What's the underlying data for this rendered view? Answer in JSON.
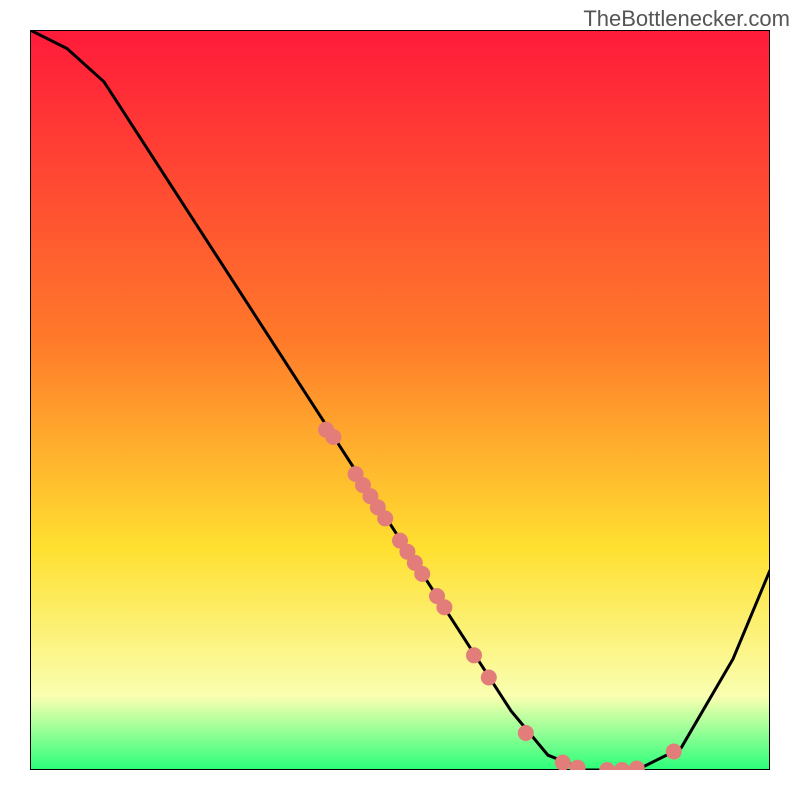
{
  "watermark": "TheBottlenecker.com",
  "chart_data": {
    "type": "line",
    "title": "",
    "xlabel": "",
    "ylabel": "",
    "xlim": [
      0,
      100
    ],
    "ylim": [
      0,
      100
    ],
    "grid": false,
    "gradient_bg": {
      "top": "#ff1a3a",
      "mid1": "#ff7a2a",
      "mid2": "#ffe030",
      "low": "#faffb0",
      "bottom": "#2aff7a"
    },
    "curve": {
      "name": "bottleneck-curve",
      "color": "#000000",
      "points": [
        [
          0,
          100
        ],
        [
          5,
          97.5
        ],
        [
          10,
          93
        ],
        [
          65,
          8
        ],
        [
          70,
          2
        ],
        [
          75,
          0
        ],
        [
          82,
          0
        ],
        [
          88,
          3
        ],
        [
          95,
          15
        ],
        [
          100,
          27
        ]
      ]
    },
    "markers": {
      "color": "#e27d7a",
      "radius": 8,
      "points": [
        [
          40,
          46
        ],
        [
          41,
          45
        ],
        [
          44,
          40
        ],
        [
          45,
          38.5
        ],
        [
          46,
          37
        ],
        [
          47,
          35.5
        ],
        [
          48,
          34
        ],
        [
          50,
          31
        ],
        [
          51,
          29.5
        ],
        [
          52,
          28
        ],
        [
          53,
          26.5
        ],
        [
          55,
          23.5
        ],
        [
          56,
          22
        ],
        [
          60,
          15.5
        ],
        [
          62,
          12.5
        ],
        [
          67,
          5
        ],
        [
          72,
          1
        ],
        [
          74,
          0.3
        ],
        [
          78,
          0
        ],
        [
          80,
          0
        ],
        [
          82,
          0.2
        ],
        [
          87,
          2.5
        ]
      ]
    }
  }
}
